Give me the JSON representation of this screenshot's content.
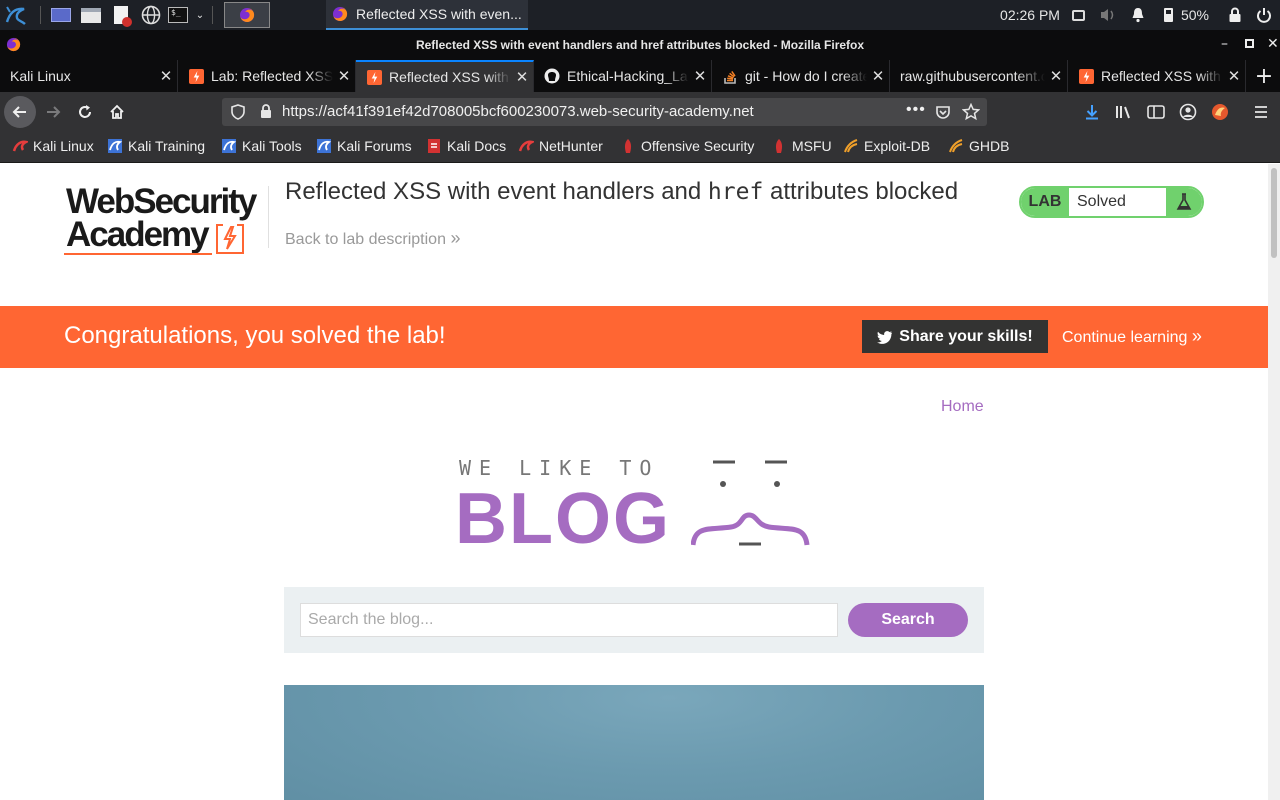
{
  "panel": {
    "window_task_title": "Reflected XSS with even...",
    "clock": "02:26 PM",
    "battery": "50%"
  },
  "window": {
    "title": "Reflected XSS with event handlers and href attributes blocked - Mozilla Firefox"
  },
  "tabs": [
    {
      "label": "Kali Linux",
      "icon": "none"
    },
    {
      "label": "Lab: Reflected XSS with",
      "icon": "portswigger-icon"
    },
    {
      "label": "Reflected XSS with event",
      "icon": "portswigger-icon",
      "active": true
    },
    {
      "label": "Ethical-Hacking_Labs",
      "icon": "github-icon"
    },
    {
      "label": "git - How do I create",
      "icon": "stackoverflow-icon"
    },
    {
      "label": "raw.githubusercontent.com",
      "icon": "none"
    },
    {
      "label": "Reflected XSS with event",
      "icon": "portswigger-icon"
    }
  ],
  "navbar": {
    "url": "https://acf41f391ef42d708005bcf600230073.web-security-academy.net",
    "more": "•••"
  },
  "bookmarks": [
    {
      "label": "Kali Linux"
    },
    {
      "label": "Kali Training"
    },
    {
      "label": "Kali Tools"
    },
    {
      "label": "Kali Forums"
    },
    {
      "label": "Kali Docs"
    },
    {
      "label": "NetHunter"
    },
    {
      "label": "Offensive Security"
    },
    {
      "label": "MSFU"
    },
    {
      "label": "Exploit-DB"
    },
    {
      "label": "GHDB"
    }
  ],
  "header": {
    "logo_line1": "WebSecurity",
    "logo_line2": "Academy",
    "title_part1": "Reflected XSS with event handlers and ",
    "title_code": "href",
    "title_part2": " attributes blocked",
    "back_link": "Back to lab description",
    "back_chevron": "»",
    "lab_label": "LAB",
    "lab_status": "Solved"
  },
  "banner": {
    "message": "Congratulations, you solved the lab!",
    "share_label": "Share your skills!",
    "continue_label": "Continue learning",
    "continue_chevron": "»"
  },
  "blog": {
    "home_link": "Home",
    "tagline": "WE LIKE TO",
    "wordmark": "BLOG",
    "search_placeholder": "Search the blog...",
    "search_value": "",
    "search_button": "Search"
  },
  "colors": {
    "accent_orange": "#ff6633",
    "blog_purple": "#a56cc1",
    "lab_green": "#70d16d"
  }
}
